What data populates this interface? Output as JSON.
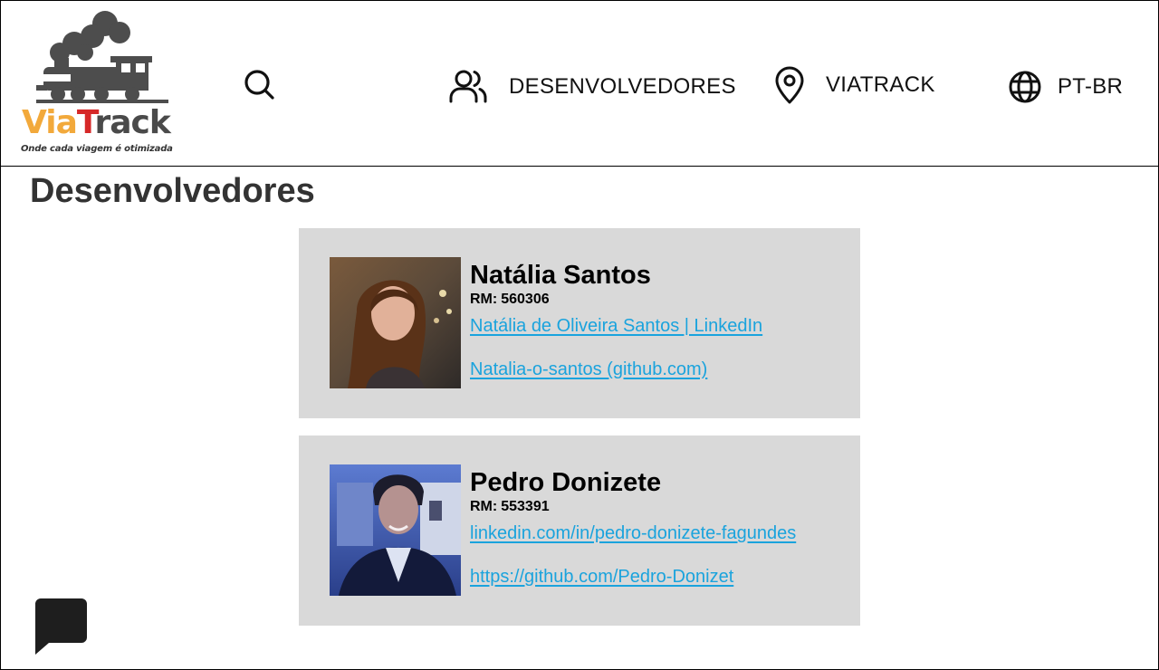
{
  "header": {
    "logo": {
      "brand_via": "Via",
      "brand_t": "T",
      "brand_rack": "rack",
      "tagline": "Onde cada viagem é otimizada",
      "colors": {
        "via": "#f2a93b",
        "t": "#d62828",
        "rack": "#4a4a4a",
        "train": "#4d4d4d"
      }
    },
    "search": {
      "icon": "search-icon"
    },
    "nav": [
      {
        "icon": "users-icon",
        "label": "DESENVOLVEDORES"
      },
      {
        "icon": "map-pin-icon",
        "label": "VIATRACK"
      },
      {
        "icon": "globe-icon",
        "label": "PT-BR"
      }
    ]
  },
  "main": {
    "title": "Desenvolvedores",
    "developers": [
      {
        "name": "Natália Santos",
        "rm_label": "RM:",
        "rm": "560306",
        "linkedin_text": "Natália de Oliveira Santos | LinkedIn",
        "github_text": "Natalia-o-santos (github.com)"
      },
      {
        "name": "Pedro Donizete",
        "rm_label": "RM:",
        "rm": "553391",
        "linkedin_text": "linkedin.com/in/pedro-donizete-fagundes",
        "github_text": "https://github.com/Pedro-Donizet"
      }
    ]
  },
  "chat": {
    "icon": "chat-bubble-icon"
  },
  "colors": {
    "card_bg": "#d9d9d9",
    "link": "#1aa3dd",
    "title": "#333333",
    "chat": "#1e1e1e"
  }
}
